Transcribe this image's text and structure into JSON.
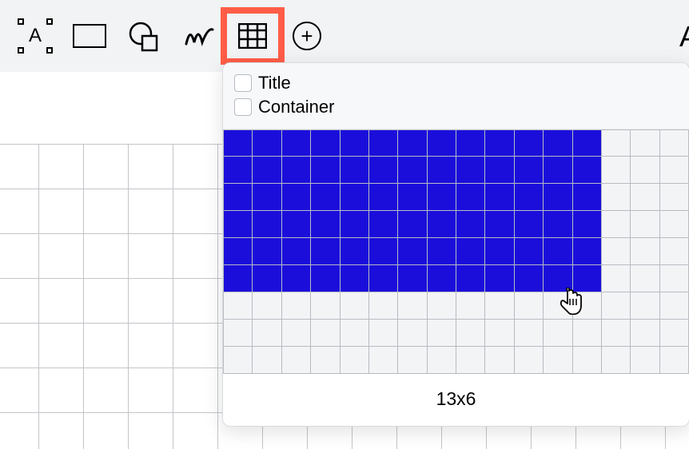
{
  "toolbar": {
    "partial_letter": "A"
  },
  "popover": {
    "title_label": "Title",
    "container_label": "Container",
    "dimensions": "13x6",
    "grid": {
      "total_cols": 16,
      "total_rows": 9,
      "selected_cols": 13,
      "selected_rows": 6
    }
  }
}
